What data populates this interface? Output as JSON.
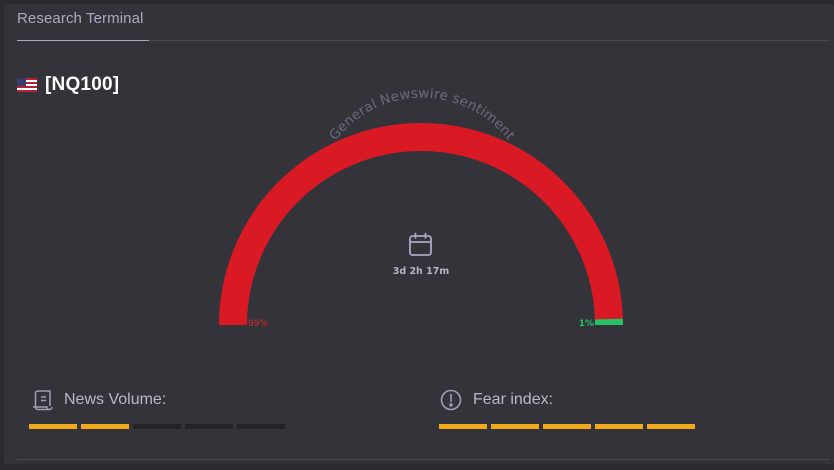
{
  "app": {
    "tab_title": "Research Terminal"
  },
  "instrument": {
    "ticker": "[NQ100]",
    "flag_icon": "us-flag-icon"
  },
  "gauge": {
    "title": "General Newswire sentiment",
    "negative_label": "99%",
    "positive_label": "1%",
    "negative_fraction": 0.99,
    "positive_fraction": 0.01,
    "negative_color": "#d91a25",
    "positive_color": "#27c266",
    "center_icon": "calendar-icon",
    "time_remaining": "3d 2h 17m"
  },
  "metrics": {
    "news_volume": {
      "label": "News Volume:",
      "icon": "scroll-icon",
      "level": 2,
      "max": 5
    },
    "fear_index": {
      "label": "Fear index:",
      "icon": "alert-circle-icon",
      "level": 5,
      "max": 5
    }
  },
  "colors": {
    "bar_active": "#f2a91a",
    "bar_inactive": "#242328",
    "background": "#343339"
  }
}
